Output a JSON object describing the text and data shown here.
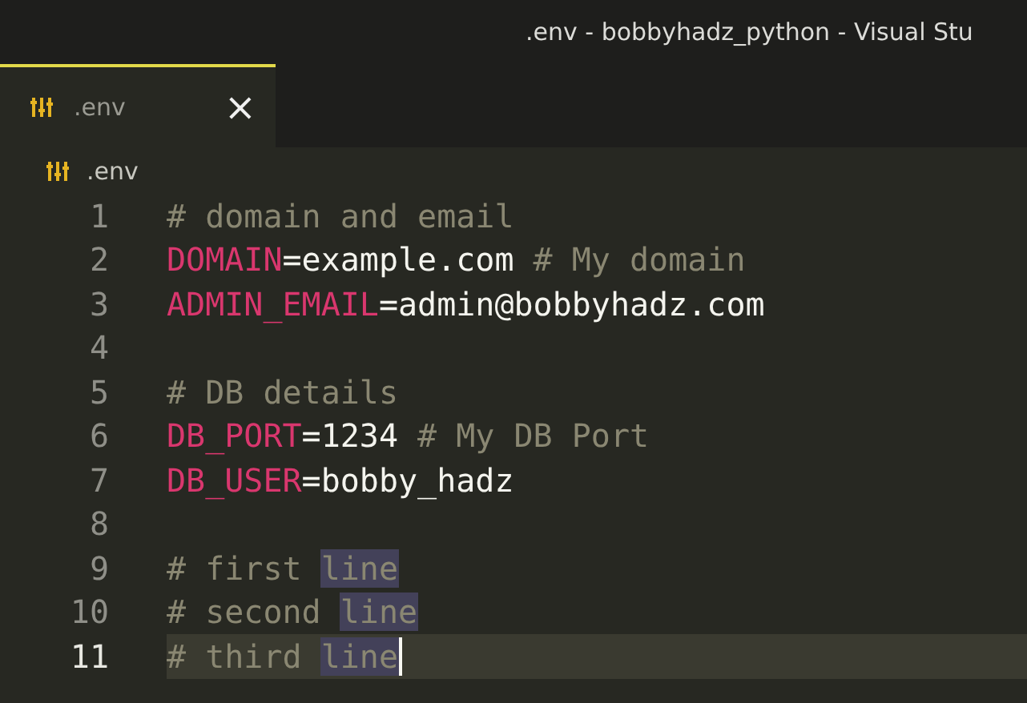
{
  "window": {
    "title": ".env - bobbyhadz_python - Visual Stu"
  },
  "tabs": [
    {
      "label": ".env",
      "selected": true,
      "close": "×"
    }
  ],
  "breadcrumb": {
    "label": ".env"
  },
  "lines": [
    {
      "number": "1",
      "current": false,
      "tokens": [
        {
          "kind": "comment",
          "text": "# domain and email",
          "highlighted": false
        }
      ]
    },
    {
      "number": "2",
      "current": false,
      "tokens": [
        {
          "kind": "key",
          "text": "DOMAIN",
          "highlighted": false
        },
        {
          "kind": "value",
          "text": "=example.com ",
          "highlighted": false
        },
        {
          "kind": "comment",
          "text": "# My domain",
          "highlighted": false
        }
      ]
    },
    {
      "number": "3",
      "current": false,
      "tokens": [
        {
          "kind": "key",
          "text": "ADMIN_EMAIL",
          "highlighted": false
        },
        {
          "kind": "value",
          "text": "=admin@bobbyhadz.com",
          "highlighted": false
        }
      ]
    },
    {
      "number": "4",
      "current": false
    },
    {
      "number": "5",
      "current": false,
      "tokens": [
        {
          "kind": "comment",
          "text": "# DB details",
          "highlighted": false
        }
      ]
    },
    {
      "number": "6",
      "current": false,
      "tokens": [
        {
          "kind": "key",
          "text": "DB_PORT",
          "highlighted": false
        },
        {
          "kind": "value",
          "text": "=1234 ",
          "highlighted": false
        },
        {
          "kind": "comment",
          "text": "# My DB Port",
          "highlighted": false
        }
      ]
    },
    {
      "number": "7",
      "current": false,
      "tokens": [
        {
          "kind": "key",
          "text": "DB_USER",
          "highlighted": false
        },
        {
          "kind": "value",
          "text": "=bobby_hadz",
          "highlighted": false
        }
      ]
    },
    {
      "number": "8",
      "current": false
    },
    {
      "number": "9",
      "current": false,
      "tokens": [
        {
          "kind": "comment",
          "text": "# first ",
          "highlighted": false
        },
        {
          "kind": "comment",
          "text": "line",
          "highlighted": true
        }
      ]
    },
    {
      "number": "10",
      "current": false,
      "tokens": [
        {
          "kind": "comment",
          "text": "# second ",
          "highlighted": false
        },
        {
          "kind": "comment",
          "text": "line",
          "highlighted": true
        }
      ]
    },
    {
      "number": "11",
      "current": true,
      "tokens": [
        {
          "kind": "comment",
          "text": "# third ",
          "highlighted": false
        },
        {
          "kind": "comment",
          "text": "line",
          "highlighted": true
        }
      ]
    }
  ]
}
